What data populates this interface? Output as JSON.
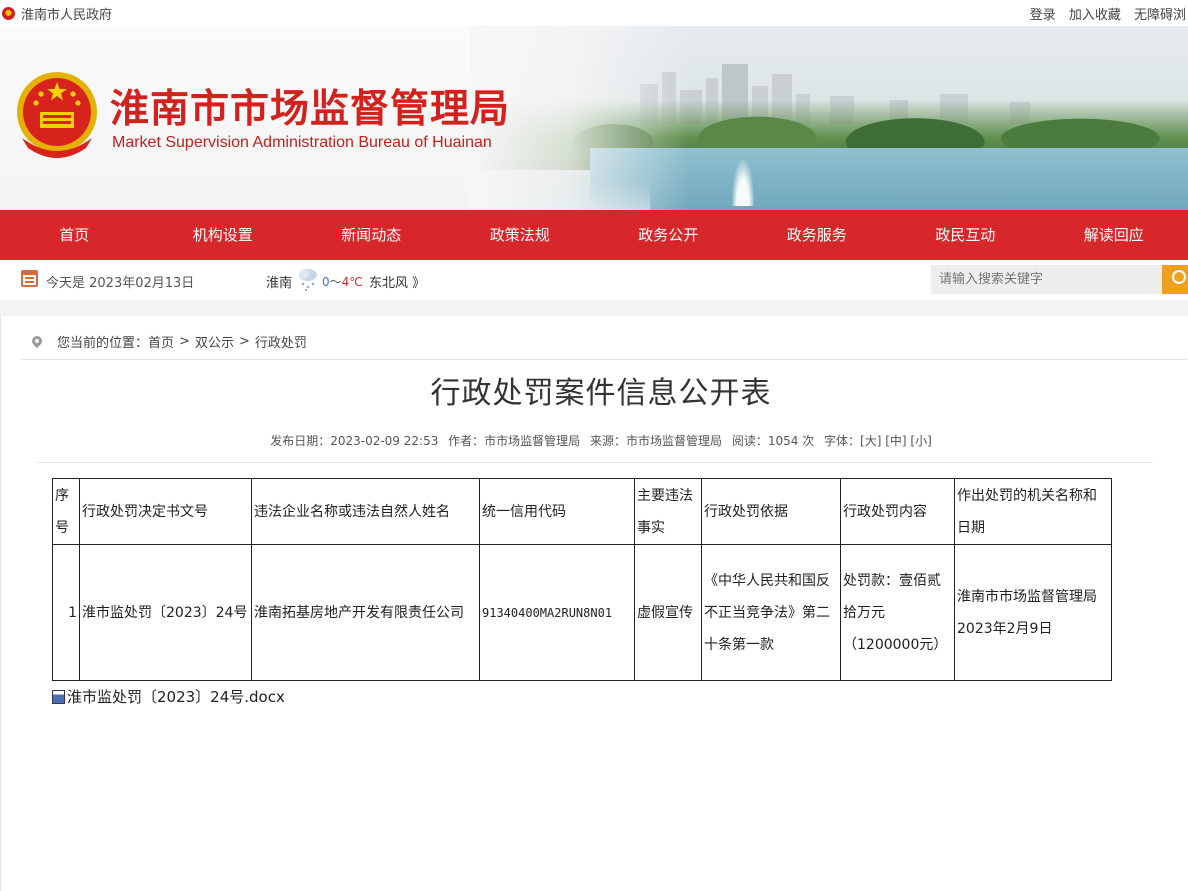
{
  "topbar": {
    "gov_name": "淮南市人民政府",
    "links": [
      "登录",
      "加入收藏",
      "无障碍浏"
    ]
  },
  "banner": {
    "title": "淮南市市场监督管理局",
    "subtitle": "Market Supervision Administration Bureau of Huainan"
  },
  "nav": {
    "items": [
      "首页",
      "机构设置",
      "新闻动态",
      "政策法规",
      "政务公开",
      "政务服务",
      "政民互动",
      "解读回应"
    ]
  },
  "info": {
    "today": "今天是 2023年02月13日",
    "city": "淮南",
    "temp_low": "0",
    "temp_sep": "～",
    "temp_high": "4℃",
    "wind": "东北风 》"
  },
  "search": {
    "placeholder": "请输入搜索关键字"
  },
  "breadcrumb": {
    "prefix": "您当前的位置：",
    "items": [
      "首页",
      "双公示",
      "行政处罚"
    ],
    "sep": ">"
  },
  "article": {
    "title": "行政处罚案件信息公开表",
    "publish_date": "发布日期：2023-02-09 22:53",
    "author": "作者：市市场监督管理局",
    "source": "来源：市市场监督管理局",
    "reads": "阅读：1054 次",
    "font_size": "字体：[大] [中] [小]"
  },
  "table": {
    "headers": [
      "序号",
      "行政处罚决定书文号",
      "违法企业名称或违法自然人姓名",
      "统一信用代码",
      "主要违法事实",
      "行政处罚依据",
      "行政处罚内容",
      "作出处罚的机关名称和日期"
    ],
    "rows": [
      [
        "1",
        "淮市监处罚〔2023〕24号",
        "淮南拓基房地产开发有限责任公司",
        "91340400MA2RUN8N01",
        "虚假宣传",
        "《中华人民共和国反不正当竞争法》第二十条第一款",
        "处罚款：壹佰贰拾万元（1200000元）",
        "淮南市市场监督管理局2023年2月9日"
      ]
    ]
  },
  "attachment": {
    "name": "淮市监处罚〔2023〕24号.docx",
    "icon": "word-doc-icon"
  }
}
